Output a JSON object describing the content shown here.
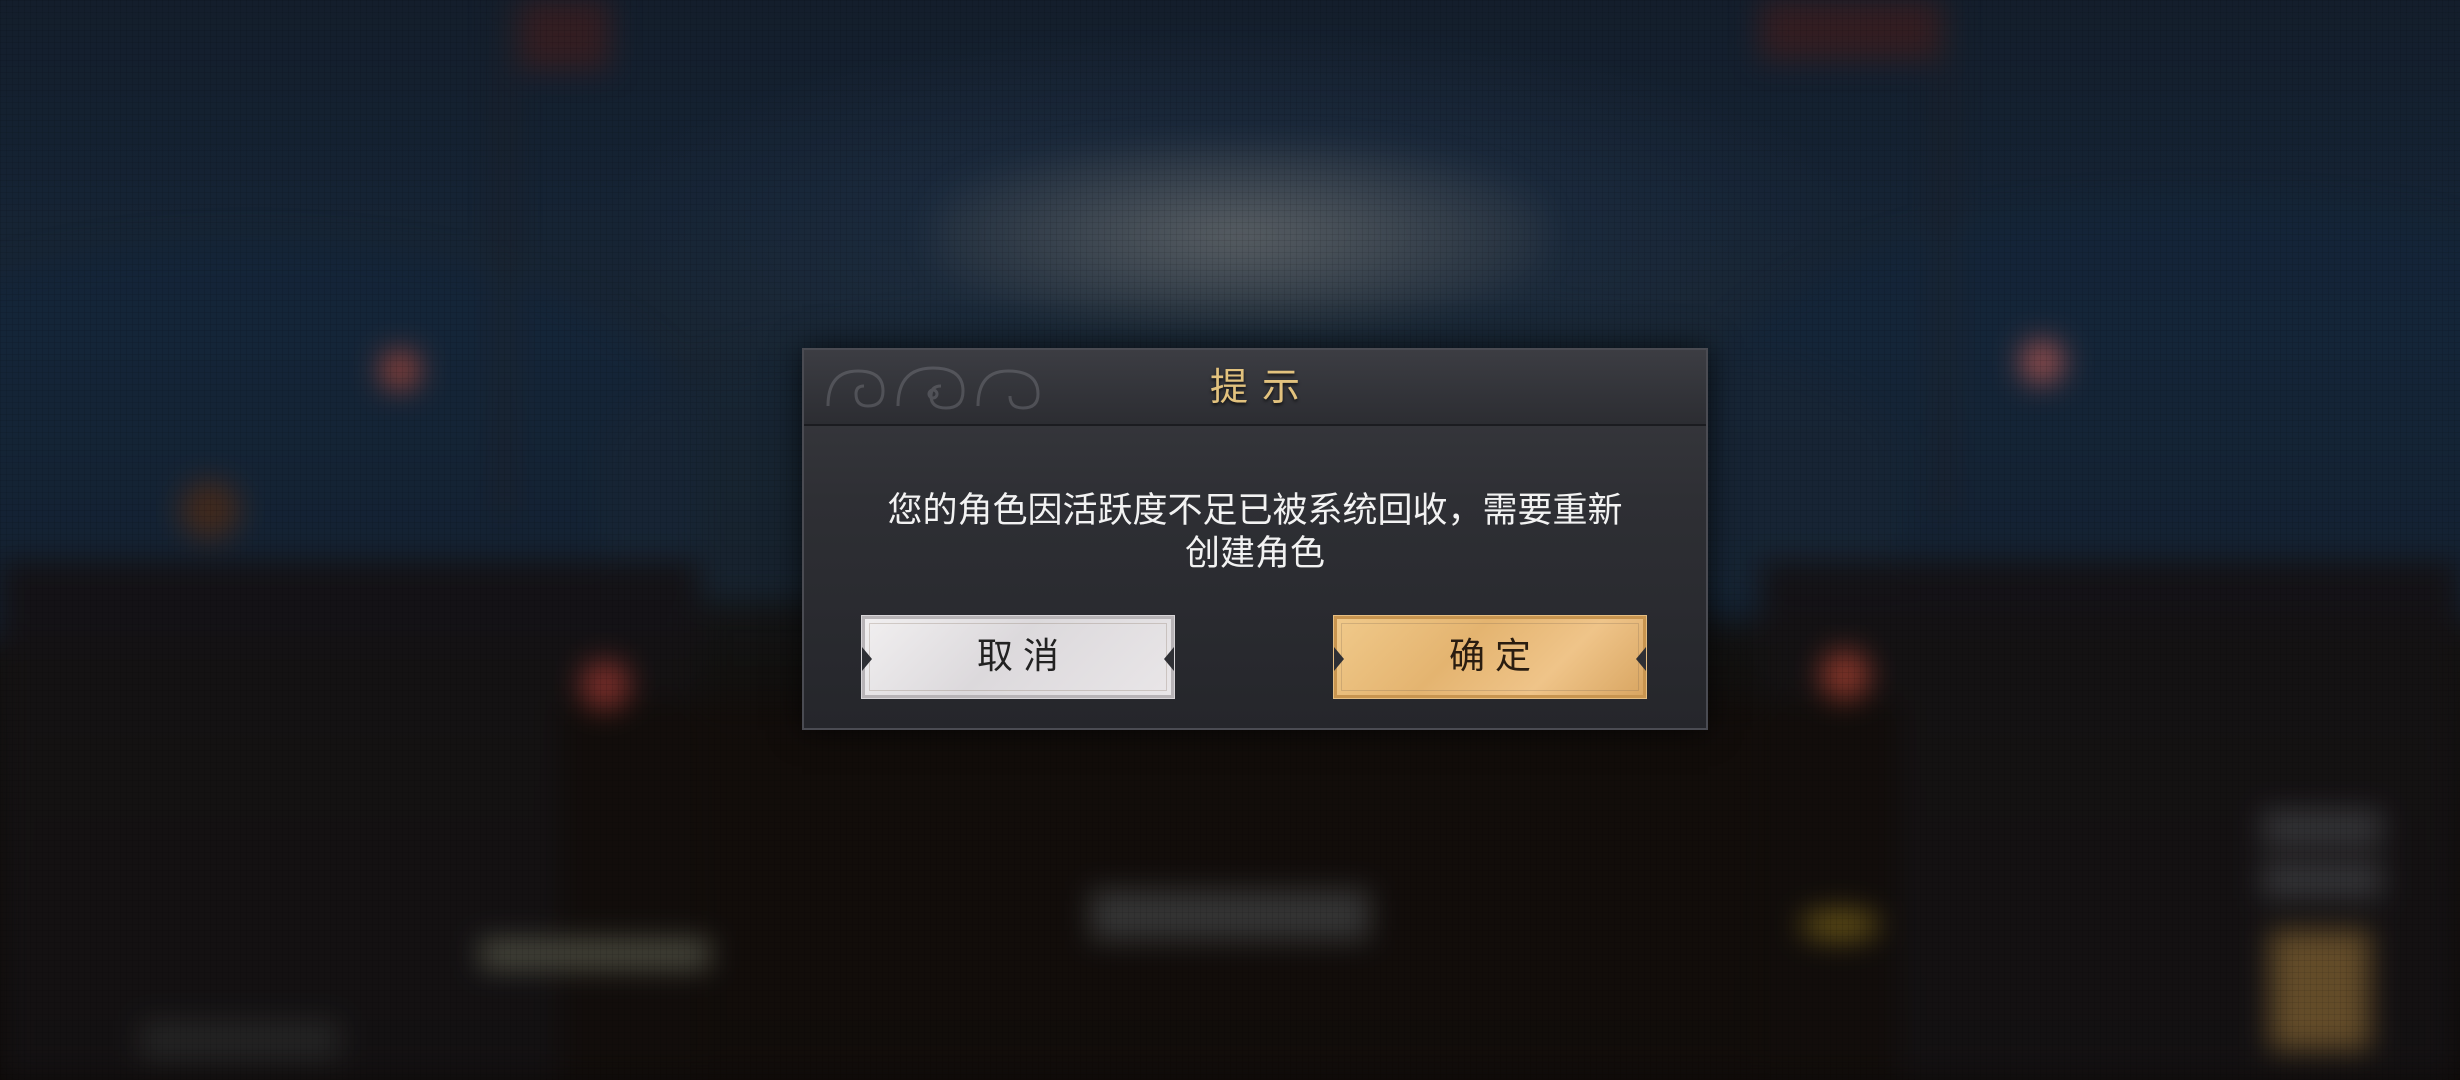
{
  "dialog": {
    "title": "提示",
    "message_line1": "您的角色因活跃度不足已被系统回收，需要重新",
    "message_line2": "创建角色",
    "cancel_label": "取消",
    "confirm_label": "确定"
  },
  "colors": {
    "title_gold": "#e2c27e",
    "confirm_button": "#e4b470",
    "cancel_button": "#e3e0e2",
    "dialog_bg": "#2e2f34"
  }
}
